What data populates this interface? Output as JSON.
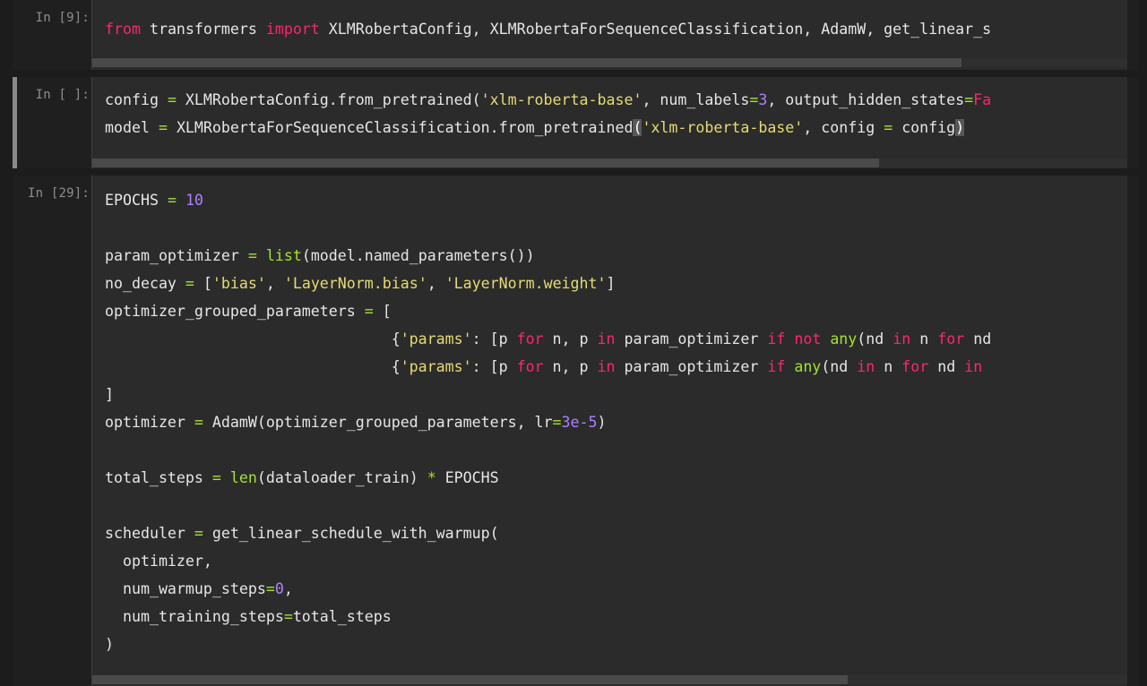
{
  "cells": [
    {
      "prompt": "In [9]:",
      "lines": [
        [
          [
            "kw",
            "from"
          ],
          [
            "pl",
            " transformers "
          ],
          [
            "kw",
            "import"
          ],
          [
            "pl",
            " XLMRobertaConfig, XLMRobertaForSequenceClassification, AdamW, get_linear_s"
          ]
        ]
      ],
      "scroll_fraction": 0.84
    },
    {
      "prompt": "In [ ]:",
      "lines": [
        [
          [
            "pl",
            "config "
          ],
          [
            "op",
            "="
          ],
          [
            "pl",
            " XLMRobertaConfig.from_pretrained("
          ],
          [
            "st",
            "'xlm-roberta-base'"
          ],
          [
            "pl",
            ", num_labels"
          ],
          [
            "op",
            "="
          ],
          [
            "nu",
            "3"
          ],
          [
            "pl",
            ", output_hidden_states"
          ],
          [
            "op",
            "="
          ],
          [
            "kw",
            "Fa"
          ]
        ],
        [
          [
            "pl",
            "model "
          ],
          [
            "op",
            "="
          ],
          [
            "pl",
            " XLMRobertaForSequenceClassification.from_pretrained"
          ],
          [
            "bk",
            "("
          ],
          [
            "st",
            "'xlm-roberta-base'"
          ],
          [
            "pl",
            ", config "
          ],
          [
            "op",
            "="
          ],
          [
            "pl",
            " config"
          ],
          [
            "bk",
            ")"
          ]
        ]
      ],
      "scroll_fraction": 0.76
    },
    {
      "prompt": "In [29]:",
      "lines": [
        [
          [
            "pl",
            "EPOCHS "
          ],
          [
            "op",
            "="
          ],
          [
            "pl",
            " "
          ],
          [
            "nu",
            "10"
          ]
        ],
        [],
        [
          [
            "pl",
            "param_optimizer "
          ],
          [
            "op",
            "="
          ],
          [
            "pl",
            " "
          ],
          [
            "bi",
            "list"
          ],
          [
            "pl",
            "(model.named_parameters())"
          ]
        ],
        [
          [
            "pl",
            "no_decay "
          ],
          [
            "op",
            "="
          ],
          [
            "pl",
            " ["
          ],
          [
            "st",
            "'bias'"
          ],
          [
            "pl",
            ", "
          ],
          [
            "st",
            "'LayerNorm.bias'"
          ],
          [
            "pl",
            ", "
          ],
          [
            "st",
            "'LayerNorm.weight'"
          ],
          [
            "pl",
            "]"
          ]
        ],
        [
          [
            "pl",
            "optimizer_grouped_parameters "
          ],
          [
            "op",
            "="
          ],
          [
            "pl",
            " ["
          ]
        ],
        [
          [
            "pl",
            "                                {"
          ],
          [
            "st",
            "'params'"
          ],
          [
            "pl",
            ": [p "
          ],
          [
            "kw",
            "for"
          ],
          [
            "pl",
            " n, p "
          ],
          [
            "kw",
            "in"
          ],
          [
            "pl",
            " param_optimizer "
          ],
          [
            "kw",
            "if"
          ],
          [
            "pl",
            " "
          ],
          [
            "kw",
            "not"
          ],
          [
            "pl",
            " "
          ],
          [
            "bi",
            "any"
          ],
          [
            "pl",
            "(nd "
          ],
          [
            "kw",
            "in"
          ],
          [
            "pl",
            " n "
          ],
          [
            "kw",
            "for"
          ],
          [
            "pl",
            " nd"
          ]
        ],
        [
          [
            "pl",
            "                                {"
          ],
          [
            "st",
            "'params'"
          ],
          [
            "pl",
            ": [p "
          ],
          [
            "kw",
            "for"
          ],
          [
            "pl",
            " n, p "
          ],
          [
            "kw",
            "in"
          ],
          [
            "pl",
            " param_optimizer "
          ],
          [
            "kw",
            "if"
          ],
          [
            "pl",
            " "
          ],
          [
            "bi",
            "any"
          ],
          [
            "pl",
            "(nd "
          ],
          [
            "kw",
            "in"
          ],
          [
            "pl",
            " n "
          ],
          [
            "kw",
            "for"
          ],
          [
            "pl",
            " nd "
          ],
          [
            "kw",
            "in"
          ]
        ],
        [
          [
            "pl",
            "]"
          ]
        ],
        [
          [
            "pl",
            "optimizer "
          ],
          [
            "op",
            "="
          ],
          [
            "pl",
            " AdamW(optimizer_grouped_parameters, lr"
          ],
          [
            "op",
            "="
          ],
          [
            "nu",
            "3e-5"
          ],
          [
            "pl",
            ")"
          ]
        ],
        [],
        [
          [
            "pl",
            "total_steps "
          ],
          [
            "op",
            "="
          ],
          [
            "pl",
            " "
          ],
          [
            "bi",
            "len"
          ],
          [
            "pl",
            "(dataloader_train) "
          ],
          [
            "op",
            "*"
          ],
          [
            "pl",
            " EPOCHS"
          ]
        ],
        [],
        [
          [
            "pl",
            "scheduler "
          ],
          [
            "op",
            "="
          ],
          [
            "pl",
            " get_linear_schedule_with_warmup("
          ]
        ],
        [
          [
            "pl",
            "  optimizer,"
          ]
        ],
        [
          [
            "pl",
            "  num_warmup_steps"
          ],
          [
            "op",
            "="
          ],
          [
            "nu",
            "0"
          ],
          [
            "pl",
            ","
          ]
        ],
        [
          [
            "pl",
            "  num_training_steps"
          ],
          [
            "op",
            "="
          ],
          [
            "pl",
            "total_steps"
          ]
        ],
        [
          [
            "pl",
            ")"
          ]
        ]
      ],
      "scroll_fraction": 0.73
    }
  ]
}
